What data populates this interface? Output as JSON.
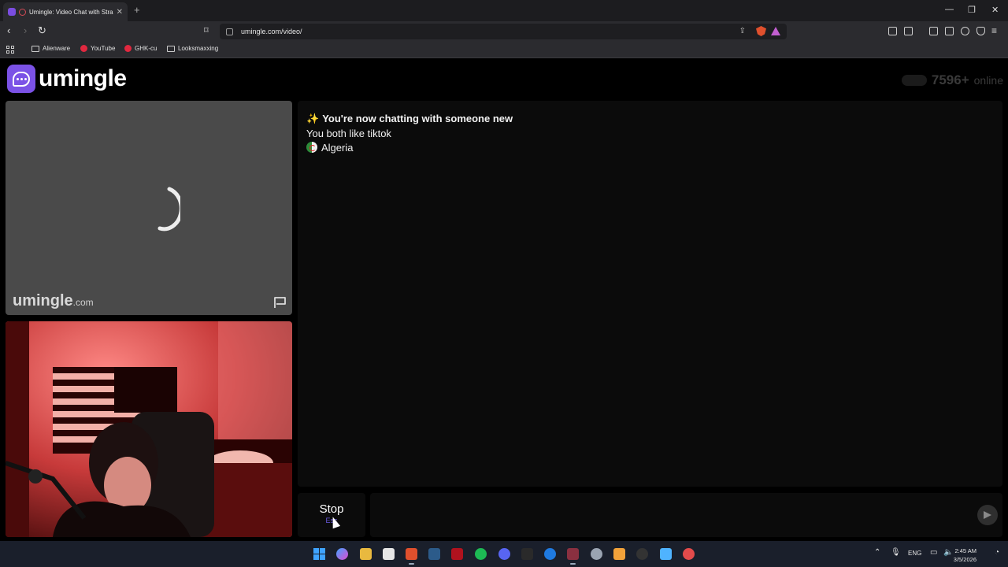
{
  "browser": {
    "tab": {
      "title": "Umingle: Video Chat with Stra"
    },
    "address": {
      "url": "umingle.com/video/"
    },
    "bookmarks": [
      "Alienware",
      "YouTube",
      "GHK-cu",
      "Looksmaxxing"
    ]
  },
  "site": {
    "logo_text": "umingle",
    "online_count": "7596+",
    "online_label": "online"
  },
  "stranger_video": {
    "watermark_main": "umingle",
    "watermark_suffix": ".com",
    "report_icon": "flag-icon"
  },
  "chat": {
    "sparkle": "✨",
    "headline": "You're now chatting with someone new",
    "common_interest": "You both like tiktok",
    "country": "Algeria"
  },
  "controls": {
    "stop_label": "Stop",
    "esc_label": "Esc",
    "message_placeholder": "",
    "send_icon": "send-icon"
  },
  "taskbar": {
    "language": "ENG",
    "time": "2:45 AM",
    "date": "3/5/2026"
  },
  "colors": {
    "brand": "#7b52e6",
    "page_bg": "#000000",
    "panel_bg": "#0b0b0b"
  }
}
